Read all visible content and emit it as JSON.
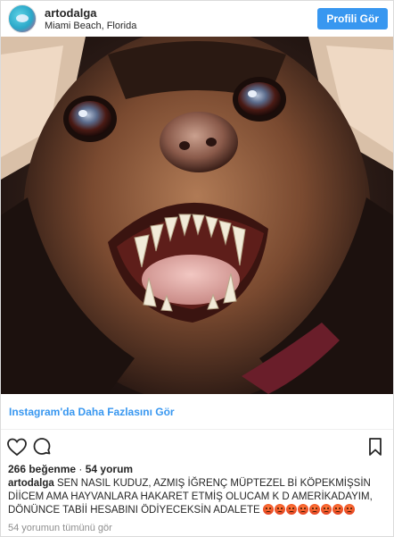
{
  "header": {
    "username": "artodalga",
    "location": "Miami Beach, Florida",
    "profile_button": "Profili Gör"
  },
  "post": {
    "more_link": "Instagram'da Daha Fazlasını Gör",
    "likes_count": "266 beğenme",
    "separator": "·",
    "comments_count": "54 yorum",
    "caption_user": "artodalga",
    "caption_text": "SEN NASIL KUDUZ, AZMIŞ İĞRENÇ MÜPTEZEL Bİ KÖPEKMİŞSİN DİİCEM AMA HAYVANLARA HAKARET ETMİŞ OLUCAM K D AMERİKADAYIM, DÖNÜNCE TABİİ HESABINI ÖDİYECEKSİN ADALETE",
    "emoji_count": 8,
    "emoji_name": "angry-face-emoji",
    "view_all_comments": "54 yorumun tümünü gör"
  },
  "icons": {
    "like": "heart-outline-icon",
    "comment": "speech-bubble-icon",
    "save": "bookmark-icon"
  },
  "colors": {
    "accent": "#3897f0",
    "text": "#262626",
    "muted": "#8e8e8e"
  }
}
